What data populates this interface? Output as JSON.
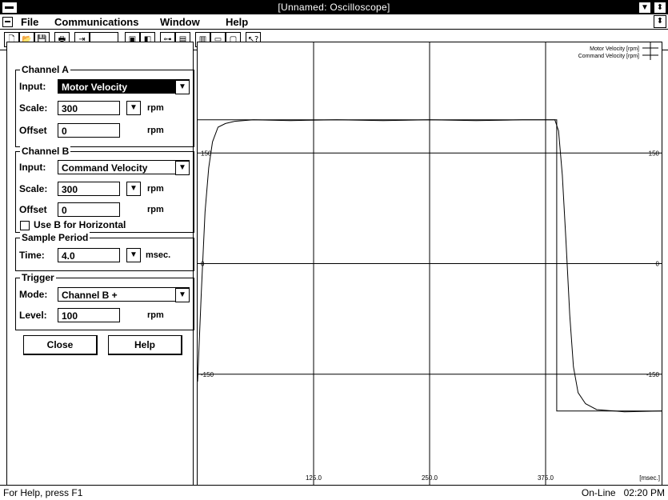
{
  "window": {
    "title": "[Unnamed: Oscilloscope]"
  },
  "menu": [
    {
      "label": "File",
      "ul": "F"
    },
    {
      "label": "Communications",
      "ul": "C"
    },
    {
      "label": "Window",
      "ul": "W"
    },
    {
      "label": "Help",
      "ul": "H"
    }
  ],
  "toolbar": [
    "new-file-icon",
    "open-file-icon",
    "save-icon",
    "print-icon",
    "connect-icon",
    "blank",
    "drive-icon",
    "terminal-icon",
    "settings-icon",
    "tuning-icon",
    "scope-icon",
    "window-icon",
    "monitor-icon",
    "context-help-icon"
  ],
  "channel_a": {
    "title": "Channel A",
    "input_label": "Input:",
    "input_value": "Motor Velocity",
    "scale_label": "Scale:",
    "scale_value": "300",
    "scale_unit": "rpm",
    "offset_label": "Offset",
    "offset_value": "0",
    "offset_unit": "rpm"
  },
  "channel_b": {
    "title": "Channel B",
    "input_label": "Input:",
    "input_value": "Command Velocity",
    "scale_label": "Scale:",
    "scale_value": "300",
    "scale_unit": "rpm",
    "offset_label": "Offset",
    "offset_value": "0",
    "offset_unit": "rpm",
    "horizontal_label": "Use B for Horizontal"
  },
  "sample": {
    "title": "Sample Period",
    "time_label": "Time:",
    "time_value": "4.0",
    "time_unit": "msec."
  },
  "trigger": {
    "title": "Trigger",
    "mode_label": "Mode:",
    "mode_value": "Channel B +",
    "level_label": "Level:",
    "level_value": "100",
    "level_unit": "rpm"
  },
  "buttons": {
    "close": "Close",
    "help": "Help"
  },
  "chart_data": {
    "type": "line",
    "xlim": [
      0,
      500
    ],
    "ylim": [
      -300,
      300
    ],
    "x_ticks": [
      "125.0",
      "250.0",
      "375.0"
    ],
    "x_unit_label": "[msec.]",
    "y_ticks_left": [
      "150",
      "0",
      "-150"
    ],
    "y_ticks_right": [
      "150",
      "0",
      "-150"
    ],
    "series": [
      {
        "name": "Motor Velocity [rpm]",
        "points": [
          [
            0,
            -160
          ],
          [
            4,
            -40
          ],
          [
            8,
            70
          ],
          [
            12,
            130
          ],
          [
            16,
            165
          ],
          [
            22,
            185
          ],
          [
            30,
            190
          ],
          [
            40,
            193
          ],
          [
            60,
            195
          ],
          [
            100,
            194
          ],
          [
            150,
            195
          ],
          [
            200,
            194
          ],
          [
            250,
            195
          ],
          [
            300,
            194
          ],
          [
            350,
            195
          ],
          [
            385,
            195
          ],
          [
            389,
            180
          ],
          [
            393,
            120
          ],
          [
            397,
            30
          ],
          [
            401,
            -70
          ],
          [
            405,
            -140
          ],
          [
            410,
            -175
          ],
          [
            418,
            -190
          ],
          [
            430,
            -198
          ],
          [
            460,
            -201
          ],
          [
            500,
            -200
          ]
        ]
      },
      {
        "name": "Command Velocity [rpm]",
        "points": [
          [
            0,
            195
          ],
          [
            387,
            195
          ],
          [
            387,
            -200
          ],
          [
            500,
            -200
          ]
        ]
      }
    ]
  },
  "status": {
    "help_text": "For Help, press F1",
    "connection": "On-Line",
    "time": "02:20 PM"
  }
}
